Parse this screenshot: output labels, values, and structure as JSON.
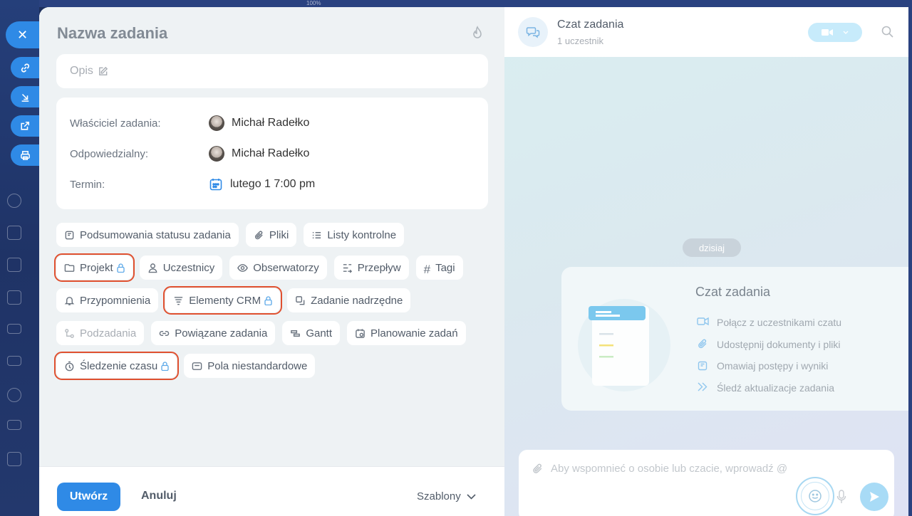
{
  "background": {
    "zoom_label": "100%"
  },
  "task": {
    "title_placeholder": "Nazwa zadania",
    "description_placeholder": "Opis"
  },
  "fields": {
    "owner_label": "Właściciel zadania:",
    "owner_value": "Michał Radełko",
    "responsible_label": "Odpowiedzialny:",
    "responsible_value": "Michał Radełko",
    "deadline_label": "Termin:",
    "deadline_value": "lutego 1 7:00 pm"
  },
  "chips": {
    "status_summaries": "Podsumowania statusu zadania",
    "files": "Pliki",
    "checklists": "Listy kontrolne",
    "project": "Projekt",
    "participants": "Uczestnicy",
    "observers": "Obserwatorzy",
    "flow": "Przepływ",
    "tags": "Tagi",
    "reminders": "Przypomnienia",
    "crm_items": "Elementy CRM",
    "parent_task": "Zadanie nadrzędne",
    "subtasks": "Podzadania",
    "related_tasks": "Powiązane zadania",
    "gantt": "Gantt",
    "task_planning": "Planowanie zadań",
    "time_tracking": "Śledzenie czasu",
    "custom_fields": "Pola niestandardowe"
  },
  "footer": {
    "create": "Utwórz",
    "cancel": "Anuluj",
    "templates": "Szablony"
  },
  "chat": {
    "title": "Czat zadania",
    "subtitle": "1 uczestnik",
    "day_separator": "dzisiaj",
    "welcome_title": "Czat zadania",
    "welcome_items": [
      "Połącz z uczestnikami czatu",
      "Udostępnij dokumenty i pliki",
      "Omawiaj postępy i wyniki",
      "Śledź aktualizacje zadania"
    ],
    "composer_placeholder": "Aby wspomnieć o osobie lub czacie, wprowadź @"
  },
  "colors": {
    "accent": "#2f8ae6",
    "highlight": "#e0502f",
    "lock": "#5ba8e8"
  }
}
